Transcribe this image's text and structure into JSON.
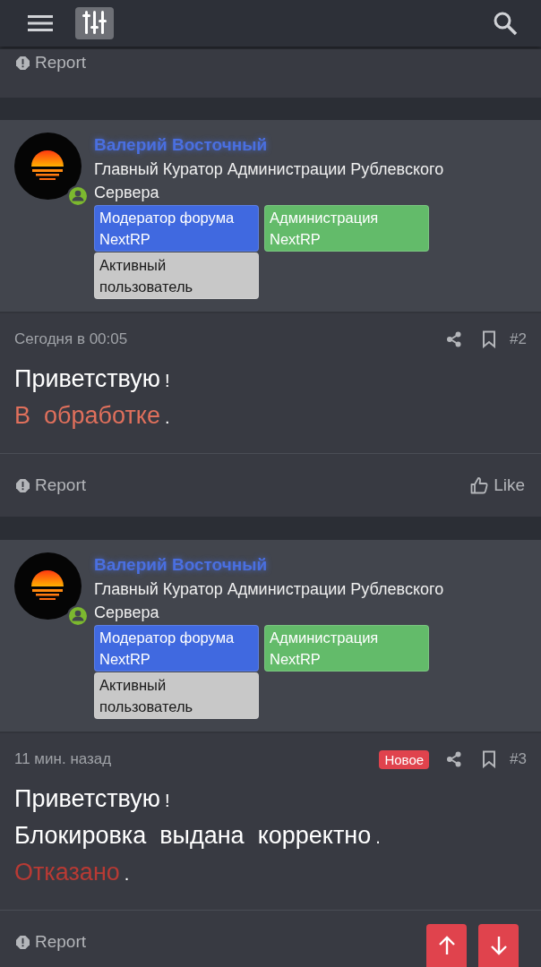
{
  "top_report": {
    "label": "Report"
  },
  "posts": [
    {
      "author": "Валерий Восточный",
      "title": "Главный Куратор Администрации Рублевского Сервера",
      "online": true,
      "badges": [
        {
          "label": "Модератор форума NextRP",
          "color": "#4069e0"
        },
        {
          "label": "Администрация NextRP",
          "color": "#63bb6a"
        },
        {
          "label": "Активный пользователь",
          "color": "#c8c8c8"
        }
      ],
      "time": "Сегодня в 00:05",
      "number": "#2",
      "lines": [
        [
          {
            "text": "Приветствую",
            "color": "#ffffff",
            "small": false
          },
          {
            "text": "!",
            "small": true
          }
        ],
        [
          {
            "text": "В  обработке",
            "color": "#e0705c",
            "small": false
          },
          {
            "text": ".",
            "small": true
          }
        ]
      ],
      "report": "Report",
      "like": "Like"
    },
    {
      "author": "Валерий Восточный",
      "title": "Главный Куратор Администрации Рублевского Сервера",
      "online": true,
      "badges": [
        {
          "label": "Модератор форума NextRP",
          "color": "#4069e0"
        },
        {
          "label": "Администрация NextRP",
          "color": "#63bb6a"
        },
        {
          "label": "Активный пользователь",
          "color": "#c8c8c8"
        }
      ],
      "time": "11 мин. назад",
      "new_label": "Новое",
      "number": "#3",
      "lines": [
        [
          {
            "text": "Приветствую",
            "color": "#ffffff",
            "small": false
          },
          {
            "text": "!",
            "small": true
          }
        ],
        [
          {
            "text": "Блокировка  выдана  корректно",
            "color": "#ffffff",
            "small": false
          },
          {
            "text": ".",
            "small": true
          }
        ],
        [
          {
            "text": "Отказано",
            "color": "#b83a34",
            "small": false
          },
          {
            "text": ".",
            "small": true
          }
        ]
      ],
      "report": "Report"
    }
  ]
}
